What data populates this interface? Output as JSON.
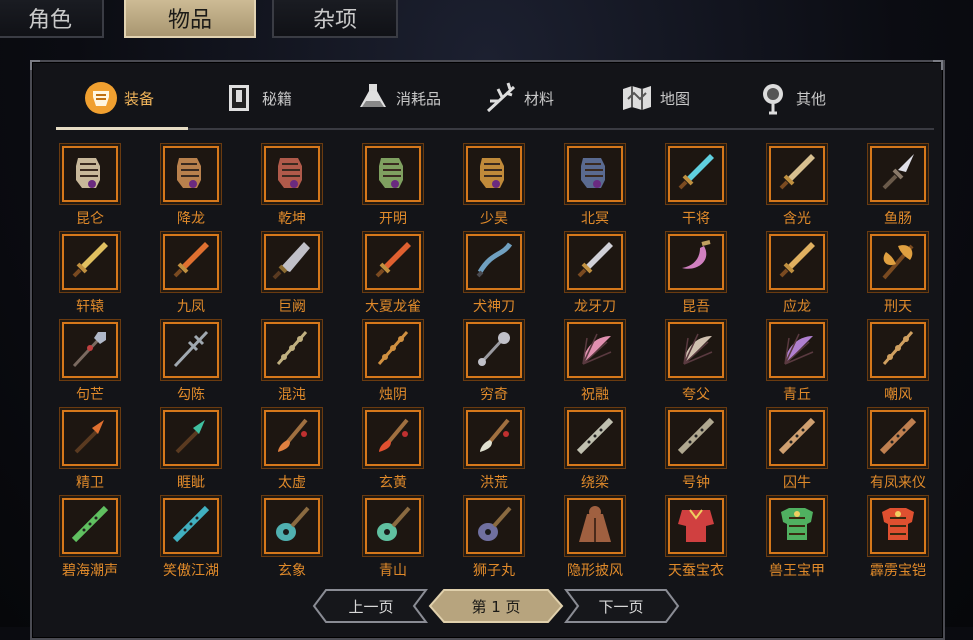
{
  "top_tabs": [
    {
      "label": "角色",
      "active": false
    },
    {
      "label": "物品",
      "active": true
    },
    {
      "label": "杂项",
      "active": false
    }
  ],
  "category_tabs": [
    {
      "label": "装备",
      "icon": "armor-icon",
      "active": true
    },
    {
      "label": "秘籍",
      "icon": "book-icon",
      "active": false
    },
    {
      "label": "消耗品",
      "icon": "potion-icon",
      "active": false
    },
    {
      "label": "材料",
      "icon": "herb-icon",
      "active": false
    },
    {
      "label": "地图",
      "icon": "map-icon",
      "active": false
    },
    {
      "label": "其他",
      "icon": "lantern-icon",
      "active": false
    }
  ],
  "items": [
    {
      "name": "昆仑",
      "icon": "gauntlet-icon",
      "color": "#c8b89a"
    },
    {
      "name": "降龙",
      "icon": "gauntlet-icon",
      "color": "#b9814d"
    },
    {
      "name": "乾坤",
      "icon": "gauntlet-icon",
      "color": "#b05a4a"
    },
    {
      "name": "开明",
      "icon": "gauntlet-icon",
      "color": "#7fa060"
    },
    {
      "name": "少昊",
      "icon": "gauntlet-icon",
      "color": "#c08a3a"
    },
    {
      "name": "北冥",
      "icon": "gauntlet-icon",
      "color": "#5a6a90"
    },
    {
      "name": "干将",
      "icon": "sword-icon",
      "color": "#60d0e0"
    },
    {
      "name": "含光",
      "icon": "sword-icon",
      "color": "#d8c090"
    },
    {
      "name": "鱼肠",
      "icon": "dagger-icon",
      "color": "#e0e0e8"
    },
    {
      "name": "轩辕",
      "icon": "sword-icon",
      "color": "#e0c060"
    },
    {
      "name": "九凤",
      "icon": "sword-icon",
      "color": "#e07030"
    },
    {
      "name": "巨阙",
      "icon": "broadsword-icon",
      "color": "#c0c0c8"
    },
    {
      "name": "大夏龙雀",
      "icon": "sword-icon",
      "color": "#e06030"
    },
    {
      "name": "犬神刀",
      "icon": "curved-blade-icon",
      "color": "#70a0c0"
    },
    {
      "name": "龙牙刀",
      "icon": "sword-icon",
      "color": "#d0d0d8"
    },
    {
      "name": "昆吾",
      "icon": "scimitar-icon",
      "color": "#d080c0"
    },
    {
      "name": "应龙",
      "icon": "sword-icon",
      "color": "#e0b060"
    },
    {
      "name": "刑天",
      "icon": "axe-icon",
      "color": "#e0a040"
    },
    {
      "name": "句芒",
      "icon": "spear-icon",
      "color": "#b0b8c8"
    },
    {
      "name": "勾陈",
      "icon": "halberd-icon",
      "color": "#a0a8b0"
    },
    {
      "name": "混沌",
      "icon": "staff-icon",
      "color": "#c0b080"
    },
    {
      "name": "烛阴",
      "icon": "staff-icon",
      "color": "#d09040"
    },
    {
      "name": "穷奇",
      "icon": "mace-icon",
      "color": "#c0c0c8"
    },
    {
      "name": "祝融",
      "icon": "fan-icon",
      "color": "#e090b0"
    },
    {
      "name": "夸父",
      "icon": "fan-icon",
      "color": "#d0c0b0"
    },
    {
      "name": "青丘",
      "icon": "fan-icon",
      "color": "#b080d0"
    },
    {
      "name": "嘲风",
      "icon": "staff-icon",
      "color": "#d0a060"
    },
    {
      "name": "精卫",
      "icon": "dart-icon",
      "color": "#e07030"
    },
    {
      "name": "睚眦",
      "icon": "dart-icon",
      "color": "#40c0a0"
    },
    {
      "name": "太虚",
      "icon": "brush-icon",
      "color": "#e08040"
    },
    {
      "name": "玄黄",
      "icon": "brush-icon",
      "color": "#e05030"
    },
    {
      "name": "洪荒",
      "icon": "brush-icon",
      "color": "#e0e0d0"
    },
    {
      "name": "绕梁",
      "icon": "flute-icon",
      "color": "#c0c0b0"
    },
    {
      "name": "号钟",
      "icon": "flute-icon",
      "color": "#b0a890"
    },
    {
      "name": "囚牛",
      "icon": "flute-icon",
      "color": "#d0a070"
    },
    {
      "name": "有凤来仪",
      "icon": "flute-icon",
      "color": "#c08050"
    },
    {
      "name": "碧海潮声",
      "icon": "flute-icon",
      "color": "#60c060"
    },
    {
      "name": "笑傲江湖",
      "icon": "flute-icon",
      "color": "#40b0c0"
    },
    {
      "name": "玄象",
      "icon": "pipa-icon",
      "color": "#50b0b0"
    },
    {
      "name": "青山",
      "icon": "pipa-icon",
      "color": "#60c0a0"
    },
    {
      "name": "狮子丸",
      "icon": "pipa-icon",
      "color": "#7070a0"
    },
    {
      "name": "隐形披风",
      "icon": "cloak-icon",
      "color": "#a06040"
    },
    {
      "name": "天蚕宝衣",
      "icon": "robe-icon",
      "color": "#d04040"
    },
    {
      "name": "兽王宝甲",
      "icon": "chest-armor-icon",
      "color": "#50b060"
    },
    {
      "name": "霹雳宝铠",
      "icon": "chest-armor-icon",
      "color": "#e05030"
    }
  ],
  "pager": {
    "prev": "上一页",
    "current": "第 1 页",
    "next": "下一页"
  }
}
